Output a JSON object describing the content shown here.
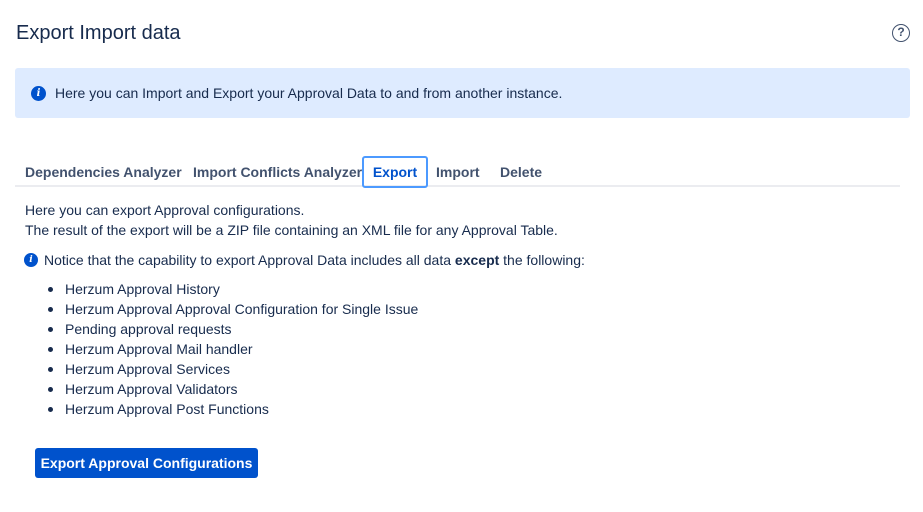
{
  "header": {
    "title": "Export Import data",
    "help_icon": "question-circle-icon",
    "help_glyph": "?"
  },
  "banner": {
    "icon": "info-icon",
    "icon_glyph": "i",
    "text": "Here you can Import and Export your Approval Data to and from another instance."
  },
  "tabs": [
    {
      "label": "Dependencies Analyzer",
      "active": false
    },
    {
      "label": "Import Conflicts Analyzer",
      "active": false
    },
    {
      "label": "Export",
      "active": true
    },
    {
      "label": "Import",
      "active": false
    },
    {
      "label": "Delete",
      "active": false
    }
  ],
  "content": {
    "intro_line1": "Here you can export Approval configurations.",
    "intro_line2": "The result of the export will be a ZIP file containing an XML file for any Approval Table.",
    "notice_icon_glyph": "i",
    "notice_prefix": "Notice that the capability to export Approval Data includes all data ",
    "notice_bold": "except",
    "notice_suffix": " the following:",
    "exclusions": [
      "Herzum Approval History",
      "Herzum Approval Approval Configuration for Single Issue",
      "Pending approval requests",
      "Herzum Approval Mail handler",
      "Herzum Approval Services",
      "Herzum Approval Validators",
      "Herzum Approval Post Functions"
    ]
  },
  "actions": {
    "export_label": "Export Approval Configurations"
  },
  "colors": {
    "primary": "#0052cc",
    "banner_bg": "#deebff",
    "text": "#172b4d",
    "tab_text": "#42526e",
    "focus_ring": "#4c9aff"
  }
}
